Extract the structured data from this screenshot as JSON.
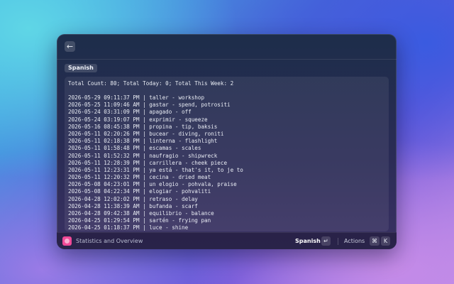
{
  "window": {
    "back_icon": "arrow-left-icon",
    "back_glyph": "←"
  },
  "tag": "Spanish",
  "summary": "Total Count: 80; Total Today: 0; Total This Week: 2",
  "entries": [
    "2026-05-29 09:11:37 PM | taller - workshop",
    "2026-05-25 11:09:46 AM | gastar - spend, potrositi",
    "2026-05-24 03:31:09 PM | apagado - off",
    "2026-05-24 03:19:07 PM | exprimir - squeeze",
    "2026-05-16 08:45:38 PM | propina - tip, baksis",
    "2026-05-11 02:20:26 PM | bucear - diving, roniti",
    "2026-05-11 02:18:38 PM | linterna - flashlight",
    "2026-05-11 01:58:48 PM | escamas - scales",
    "2026-05-11 01:52:32 PM | naufragio - shipwreck",
    "2026-05-11 12:28:39 PM | carrillera - cheek piece",
    "2026-05-11 12:23:31 PM | ya está - that's it, to je to",
    "2026-05-11 12:20:32 PM | cecina - dried meat",
    "2026-05-08 04:23:01 PM | un elogio - pohvala, praise",
    "2026-05-08 04:22:34 PM | elogiar - pohvaliti",
    "2026-04-28 12:02:02 PM | retraso - delay",
    "2026-04-28 11:38:39 AM | bufanda - scarf",
    "2026-04-28 09:42:38 AM | equilibrio - balance",
    "2026-04-25 01:29:54 PM | sartén - frying pan",
    "2026-04-25 01:18:37 PM | luce - shine"
  ],
  "footer": {
    "title": "Statistics and Overview",
    "app_icon": "app-icon",
    "primary_action": "Spanish",
    "enter_key": "↵",
    "actions_label": "Actions",
    "cmd_key": "⌘",
    "k_key": "K"
  },
  "colors": {
    "app_icon": "#f04a97",
    "window_bg": "#23294d"
  }
}
